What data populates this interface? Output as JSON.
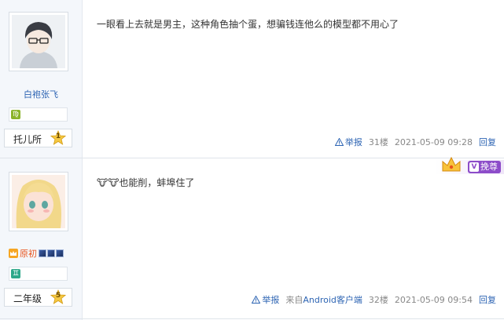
{
  "posts": [
    {
      "username": "白袍张飞",
      "zodiac_glyph": "♍",
      "zodiac_color": "#8ab32a",
      "level_name": "托儿所",
      "level_num": "1",
      "content": "一眼看上去就是男主，这种角色抽个蛋，想骗钱连他么的模型都不用心了",
      "report_label": "举报",
      "floor": "31楼",
      "time": "2021-05-09 09:28",
      "reply_label": "回复"
    },
    {
      "username": "原初",
      "zodiac_glyph": "♊",
      "zodiac_color": "#2fa88a",
      "level_name": "二年级",
      "level_num": "5",
      "content": "🐮🐮也能削，蚌埠住了",
      "vip_label": "挽尊",
      "report_label": "举报",
      "source_prefix": "来自",
      "source_link": "Android客户端",
      "floor": "32楼",
      "time": "2021-05-09 09:54",
      "reply_label": "回复"
    }
  ],
  "icons": {
    "warning": "warning-triangle-icon",
    "star": "level-star-icon",
    "crown": "crown-icon"
  },
  "colors": {
    "link": "#2d64b3",
    "meta": "#888888",
    "username_vip": "#e8541e",
    "vip_purple": "#8c4cc9"
  }
}
